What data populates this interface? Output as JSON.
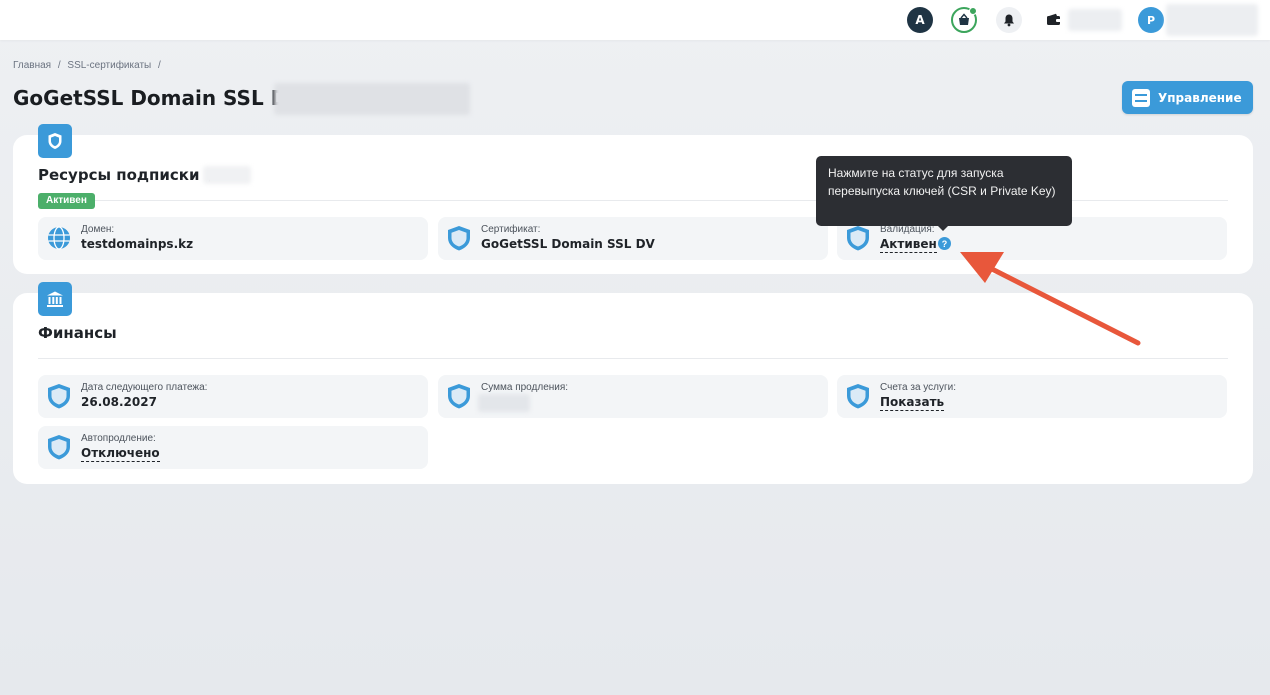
{
  "topbar": {
    "avatar_letter": "A",
    "user_initial": "P"
  },
  "breadcrumb": {
    "home": "Главная",
    "sep1": "/",
    "section": "SSL-сертификаты",
    "sep2": "/"
  },
  "page": {
    "title": "GoGetSSL Domain SSL DV",
    "manage_label": "Управление"
  },
  "subscription": {
    "title": "Ресурсы подписки",
    "title_sep": "/",
    "status_badge": "Активен",
    "fields": [
      {
        "label": "Домен:",
        "value": "testdomainps.kz",
        "icon": "globe-icon"
      },
      {
        "label": "Сертификат:",
        "value": "GoGetSSL Domain SSL DV",
        "icon": "shield-icon"
      },
      {
        "label": "Валидация:",
        "value": "Активен",
        "icon": "shield-icon",
        "help": "?"
      }
    ],
    "tooltip": "Нажмите на статус для запуска перевыпуска ключей (CSR и Private Key)"
  },
  "finance": {
    "title": "Финансы",
    "fields": [
      {
        "label": "Дата следующего платежа:",
        "value": "26.08.2027",
        "icon": "shield-icon"
      },
      {
        "label": "Сумма продления:",
        "value": "",
        "icon": "shield-icon"
      },
      {
        "label": "Счета за услуги:",
        "value": "Показать",
        "icon": "shield-icon"
      },
      {
        "label": "Автопродление:",
        "value": "Отключено",
        "icon": "shield-icon"
      }
    ]
  },
  "colors": {
    "accent": "#3b9ad9",
    "success": "#4caf6a",
    "annotation_arrow": "#e8573b",
    "tooltip_bg": "#2c2e33"
  }
}
